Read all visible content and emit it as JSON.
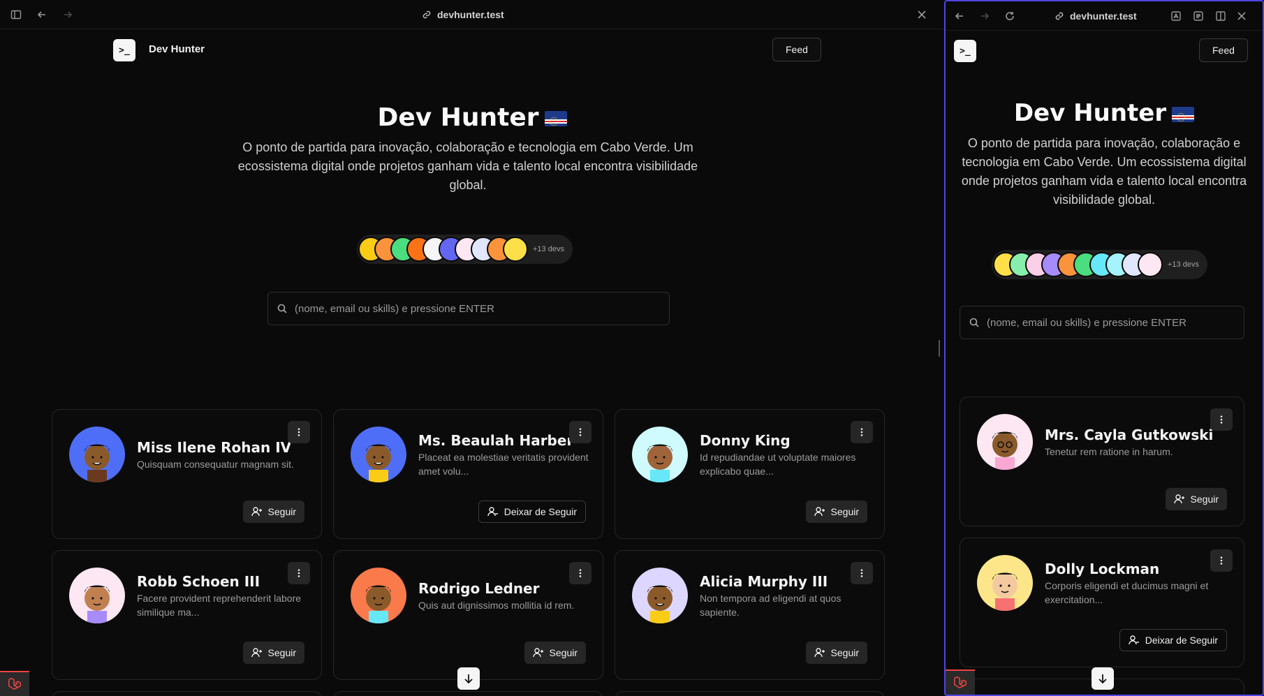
{
  "left": {
    "browser": {
      "url": "devhunter.test"
    },
    "brand": {
      "name": "Dev Hunter",
      "tile": ">_"
    },
    "nav": {
      "feed_label": "Feed"
    },
    "hero": {
      "title": "Dev Hunter",
      "subtitle": "O ponto de partida para inovação, colaboração e tecnologia em Cabo Verde. Um ecossistema digital onde projetos ganham vida e talento local encontra visibilidade global."
    },
    "devs": {
      "more_label": "+13 devs"
    },
    "search": {
      "placeholder": "(nome, email ou skills) e pressione ENTER"
    },
    "cards": [
      {
        "name": "Miss Ilene Rohan IV",
        "bio": "Quisquam consequatur magnam sit.",
        "action": "Seguir"
      },
      {
        "name": "Ms. Beaulah Harber V",
        "bio": "Placeat ea molestiae veritatis provident amet volu...",
        "action": "Deixar de Seguir"
      },
      {
        "name": "Donny King",
        "bio": "Id repudiandae ut voluptate maiores explicabo quae...",
        "action": "Seguir"
      },
      {
        "name": "Robb Schoen III",
        "bio": "Facere provident reprehenderit labore similique ma...",
        "action": "Seguir"
      },
      {
        "name": "Rodrigo Ledner",
        "bio": "Quis aut dignissimos mollitia id rem.",
        "action": "Seguir"
      },
      {
        "name": "Alicia Murphy III",
        "bio": "Non tempora ad eligendi at quos sapiente.",
        "action": "Seguir"
      }
    ]
  },
  "right": {
    "browser": {
      "url": "devhunter.test"
    },
    "brand": {
      "tile": ">_"
    },
    "nav": {
      "feed_label": "Feed"
    },
    "hero": {
      "title": "Dev Hunter",
      "subtitle": "O ponto de partida para inovação, colaboração e tecnologia em Cabo Verde. Um ecossistema digital onde projetos ganham vida e talento local encontra visibilidade global."
    },
    "devs": {
      "more_label": "+13 devs"
    },
    "search": {
      "placeholder": "(nome, email ou skills) e pressione ENTER"
    },
    "cards": [
      {
        "name": "Mrs. Cayla Gutkowski IV",
        "bio": "Tenetur rem ratione in harum.",
        "action": "Seguir"
      },
      {
        "name": "Dolly Lockman",
        "bio": "Corporis eligendi et ducimus magni et exercitation...",
        "action": "Deixar de Seguir"
      }
    ]
  },
  "colors": {
    "background": "#0a0a0a",
    "card_border": "#262626",
    "accent_frame": "#4f46e5",
    "laravel_red": "#ef4444"
  }
}
